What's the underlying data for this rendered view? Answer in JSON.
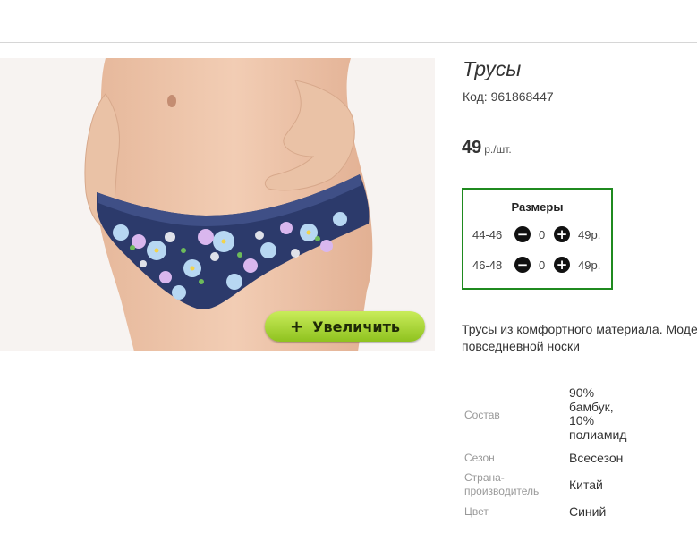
{
  "product": {
    "title": "Трусы",
    "code": "Код: 961868447",
    "price": "49",
    "price_unit": "р./шт."
  },
  "gallery": {
    "zoom_plus": "+",
    "zoom_label": "Увеличить"
  },
  "sizes": {
    "heading": "Размеры",
    "minus_glyph": "−",
    "plus_glyph": "+",
    "rows": [
      {
        "label": "44-46",
        "count": "0",
        "price": "49р."
      },
      {
        "label": "46-48",
        "count": "0",
        "price": "49р."
      }
    ]
  },
  "description": {
    "line1": "Трусы из комфортного материала. Моде",
    "line2": "повседневной носки"
  },
  "specs": [
    {
      "label": "Состав",
      "value_lines": [
        "90%",
        "бамбук,",
        "10%",
        "полиамид"
      ]
    },
    {
      "label_lines": [
        "Сезон"
      ],
      "value": "Всесезон"
    },
    {
      "label_lines": [
        "Страна-",
        "производитель"
      ],
      "value": "Китай"
    },
    {
      "label_lines": [
        "Цвет"
      ],
      "value": "Синий"
    }
  ],
  "colors": {
    "sizes_border": "#1f8a1f",
    "zoom_button": "#a9d63a",
    "fabric": "#2c3a6b"
  }
}
